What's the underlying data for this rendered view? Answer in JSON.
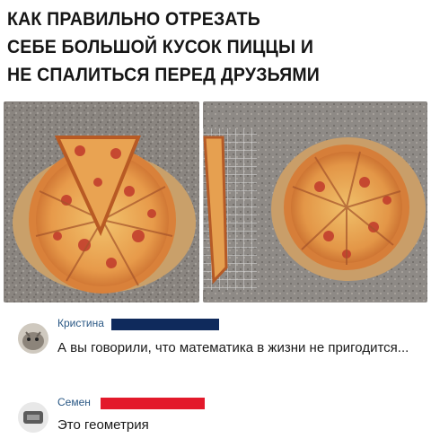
{
  "headline": {
    "lines": [
      "КАК ПРАВИЛЬНО ОТРЕЗАТЬ",
      "СЕБЕ БОЛЬШОЙ КУСОК ПИЦЦЫ И",
      "НЕ СПАЛИТЬСЯ ПЕРЕД ДРУЗЬЯМИ"
    ]
  },
  "comments": [
    {
      "author": "Кристина",
      "text": "А вы говорили, что математика в жизни не пригодится...",
      "censor_color": "#0f2a5c"
    },
    {
      "author": "Семен",
      "text": "Это геометрия",
      "censor_color": "#e3192b"
    }
  ]
}
